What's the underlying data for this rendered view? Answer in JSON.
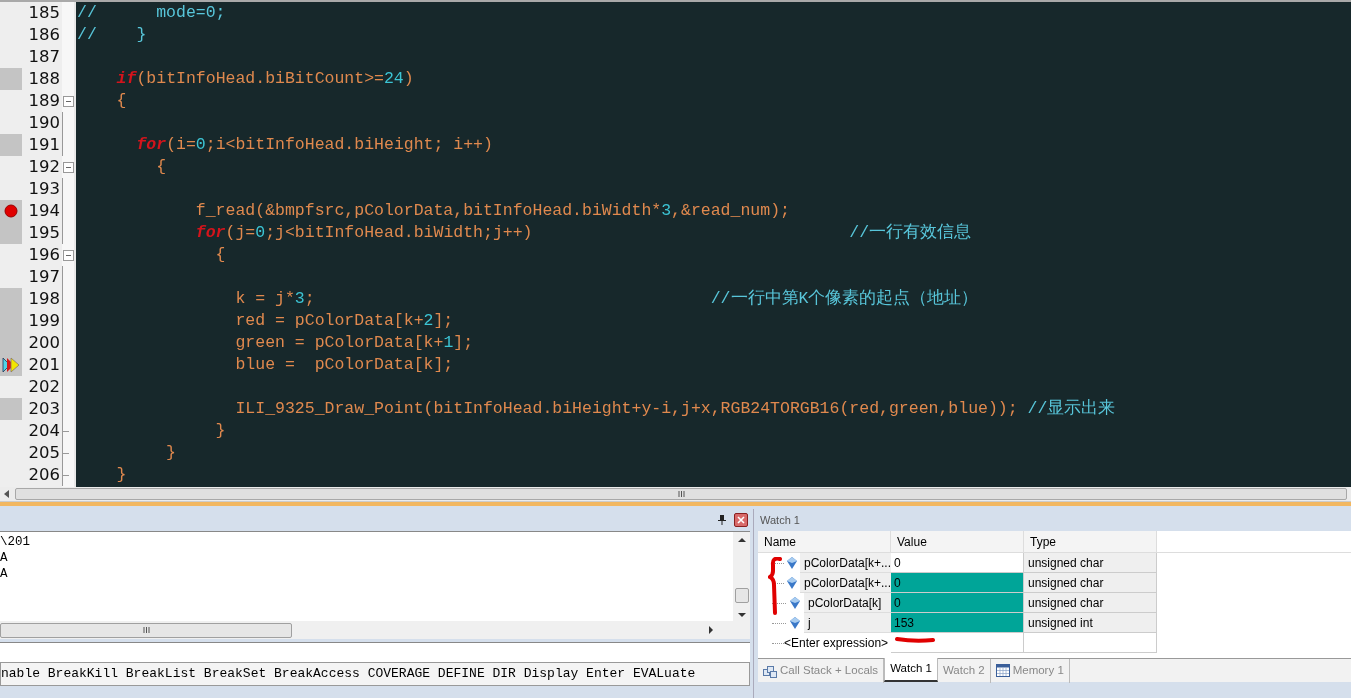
{
  "editor": {
    "lines": [
      {
        "number": "185",
        "kind": "plain",
        "executed": false,
        "breakpoint": false,
        "current": false,
        "tokens": [
          {
            "kind": "comment",
            "text": "//      mode=0;"
          }
        ]
      },
      {
        "number": "186",
        "kind": "plain",
        "executed": false,
        "breakpoint": false,
        "current": false,
        "tokens": [
          {
            "kind": "comment",
            "text": "//    }"
          }
        ]
      },
      {
        "number": "187",
        "kind": "plain",
        "executed": false,
        "breakpoint": false,
        "current": false
      },
      {
        "number": "188",
        "kind": "plain",
        "executed": true,
        "breakpoint": false,
        "current": false,
        "tokens": [
          {
            "kind": "keyword",
            "text": "    if"
          },
          {
            "kind": "plain",
            "text": "(bitInfoHead.biBitCount>="
          },
          {
            "kind": "number",
            "text": "24"
          },
          {
            "kind": "plain",
            "text": ")"
          }
        ]
      },
      {
        "number": "189",
        "kind": "fold-start",
        "executed": false,
        "breakpoint": false,
        "current": false,
        "tokens": [
          {
            "kind": "plain",
            "text": "    {"
          }
        ]
      },
      {
        "number": "190",
        "kind": "fold-body",
        "executed": false,
        "breakpoint": false,
        "current": false
      },
      {
        "number": "191",
        "kind": "fold-body",
        "executed": true,
        "breakpoint": false,
        "current": false,
        "tokens": [
          {
            "kind": "keyword",
            "text": "      for"
          },
          {
            "kind": "plain",
            "text": "(i="
          },
          {
            "kind": "number",
            "text": "0"
          },
          {
            "kind": "plain",
            "text": ";i<bitInfoHead.biHeight; i++)"
          }
        ]
      },
      {
        "number": "192",
        "kind": "fold-start",
        "executed": false,
        "breakpoint": false,
        "current": false,
        "tokens": [
          {
            "kind": "plain",
            "text": "        {"
          }
        ]
      },
      {
        "number": "193",
        "kind": "fold-body",
        "executed": false,
        "breakpoint": false,
        "current": false
      },
      {
        "number": "194",
        "kind": "fold-body",
        "executed": true,
        "breakpoint": true,
        "current": false,
        "tokens": [
          {
            "kind": "plain",
            "text": "            f_read(&bmpfsrc,pColorData,bitInfoHead.biWidth*"
          },
          {
            "kind": "number",
            "text": "3"
          },
          {
            "kind": "plain",
            "text": ",&read_num);"
          }
        ]
      },
      {
        "number": "195",
        "kind": "fold-body",
        "executed": true,
        "breakpoint": false,
        "current": false,
        "tokens": [
          {
            "kind": "keyword",
            "text": "            for"
          },
          {
            "kind": "plain",
            "text": "(j="
          },
          {
            "kind": "number",
            "text": "0"
          },
          {
            "kind": "plain",
            "text": ";j<bitInfoHead.biWidth;j++)                                "
          },
          {
            "kind": "comment",
            "text": "//一行有效信息"
          }
        ]
      },
      {
        "number": "196",
        "kind": "fold-start",
        "executed": false,
        "breakpoint": false,
        "current": false,
        "tokens": [
          {
            "kind": "plain",
            "text": "              {"
          }
        ]
      },
      {
        "number": "197",
        "kind": "fold-body",
        "executed": false,
        "breakpoint": false,
        "current": false
      },
      {
        "number": "198",
        "kind": "fold-body",
        "executed": true,
        "breakpoint": false,
        "current": false,
        "tokens": [
          {
            "kind": "plain",
            "text": "                k = j*"
          },
          {
            "kind": "number",
            "text": "3"
          },
          {
            "kind": "plain",
            "text": ";                                        "
          },
          {
            "kind": "comment",
            "text": "//一行中第K个像素的起点（地址）"
          }
        ]
      },
      {
        "number": "199",
        "kind": "fold-body",
        "executed": true,
        "breakpoint": false,
        "current": false,
        "tokens": [
          {
            "kind": "plain",
            "text": "                red = pColorData[k+"
          },
          {
            "kind": "number",
            "text": "2"
          },
          {
            "kind": "plain",
            "text": "];"
          }
        ]
      },
      {
        "number": "200",
        "kind": "fold-body",
        "executed": true,
        "breakpoint": false,
        "current": false,
        "tokens": [
          {
            "kind": "plain",
            "text": "                green = pColorData[k+"
          },
          {
            "kind": "number",
            "text": "1"
          },
          {
            "kind": "plain",
            "text": "];"
          }
        ]
      },
      {
        "number": "201",
        "kind": "fold-body",
        "executed": true,
        "breakpoint": false,
        "current": true,
        "tokens": [
          {
            "kind": "plain",
            "text": "                blue =  pColorData[k];"
          }
        ]
      },
      {
        "number": "202",
        "kind": "fold-body",
        "executed": false,
        "breakpoint": false,
        "current": false
      },
      {
        "number": "203",
        "kind": "fold-body",
        "executed": true,
        "breakpoint": false,
        "current": false,
        "tokens": [
          {
            "kind": "plain",
            "text": "                ILI_9325_Draw_Point(bitInfoHead.biHeight+y-i,j+x,RGB24TORGB16(red,green,blue)); "
          },
          {
            "kind": "comment",
            "text": "//显示出来"
          }
        ]
      },
      {
        "number": "204",
        "kind": "fold-end",
        "executed": false,
        "breakpoint": false,
        "current": false,
        "tokens": [
          {
            "kind": "plain",
            "text": "              }"
          }
        ]
      },
      {
        "number": "205",
        "kind": "fold-end",
        "executed": false,
        "breakpoint": false,
        "current": false,
        "tokens": [
          {
            "kind": "plain",
            "text": "         }"
          }
        ]
      },
      {
        "number": "206",
        "kind": "fold-end",
        "executed": false,
        "breakpoint": false,
        "current": false,
        "tokens": [
          {
            "kind": "plain",
            "text": "    }"
          }
        ]
      }
    ]
  },
  "command_window": {
    "output_lines": [
      "\\201",
      "A",
      "A"
    ],
    "command_hint": "nable BreakKill BreakList BreakSet BreakAccess COVERAGE DEFINE DIR Display Enter EVALuate"
  },
  "watch": {
    "title": "Watch 1",
    "columns": [
      "Name",
      "Value",
      "Type"
    ],
    "rows": [
      {
        "name": "pColorData[k+...",
        "value": "0",
        "type": "unsigned char",
        "changed": false
      },
      {
        "name": "pColorData[k+...",
        "value": "0",
        "type": "unsigned char",
        "changed": true
      },
      {
        "name": "pColorData[k]",
        "value": "0",
        "type": "unsigned char",
        "changed": true
      },
      {
        "name": "j",
        "value": "153",
        "type": "unsigned int",
        "changed": true
      }
    ],
    "enter_placeholder": "<Enter expression>"
  },
  "tabs": [
    {
      "label": "Call Stack + Locals",
      "kind": "stack",
      "selected": false
    },
    {
      "label": "Watch 1",
      "kind": "plain",
      "selected": true
    },
    {
      "label": "Watch 2",
      "kind": "plain",
      "selected": false
    },
    {
      "label": "Memory 1",
      "kind": "memory",
      "selected": false
    }
  ]
}
